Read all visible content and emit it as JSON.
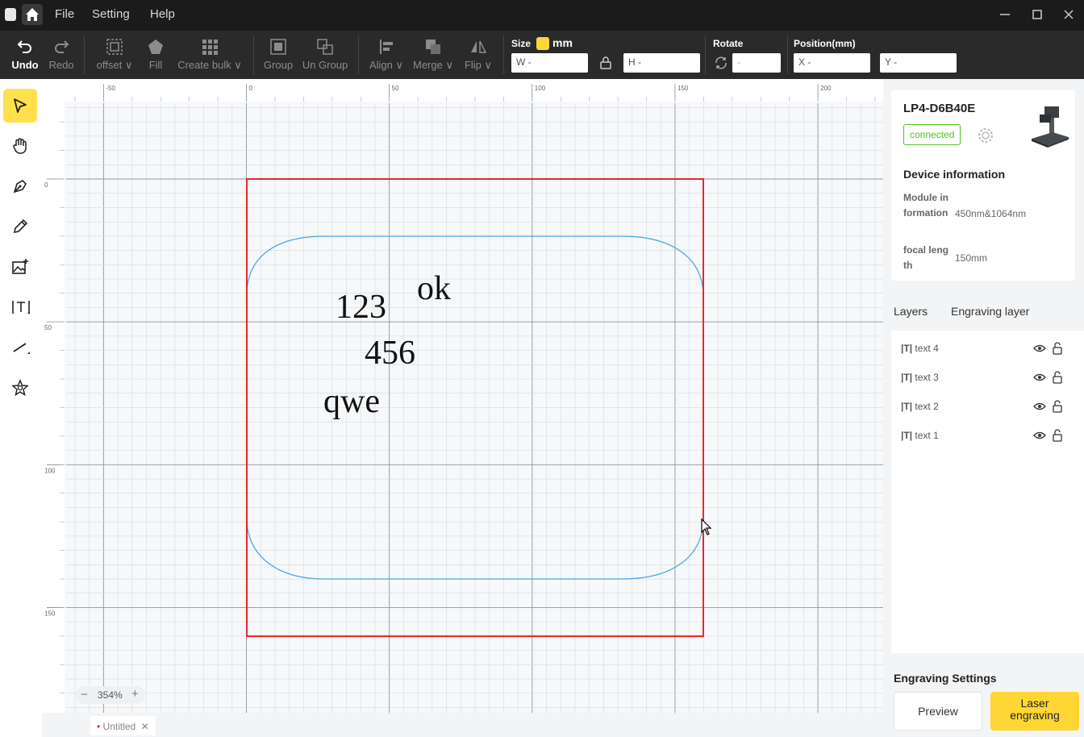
{
  "titlebar": {
    "menu": [
      "File",
      "Setting",
      "Help"
    ]
  },
  "toolbar": {
    "undo": "Undo",
    "redo": "Redo",
    "offset": "offset",
    "fill": "Fill",
    "create_bulk": "Create bulk",
    "group": "Group",
    "ungroup": "Un Group",
    "align": "Align",
    "merge": "Merge",
    "flip": "Flip",
    "size_label": "Size",
    "unit": "mm",
    "w_placeholder": "W -",
    "h_placeholder": "H -",
    "rotate_label": "Rotate",
    "rotate_value": "-",
    "position_label": "Position(mm)",
    "x_placeholder": "X -",
    "y_placeholder": "Y -"
  },
  "canvas": {
    "ruler_top": [
      "-50",
      "0",
      "50",
      "100",
      "150",
      "200"
    ],
    "ruler_left": [
      "0",
      "50",
      "100",
      "150"
    ],
    "texts": [
      "ok",
      "123",
      "456",
      "qwe"
    ],
    "zoom": "354%"
  },
  "tabs": [
    "Untitled"
  ],
  "device": {
    "name": "LP4-D6B40E",
    "status": "connected",
    "info_title": "Device information",
    "module_key": "Module information",
    "module_val": "450nm&1064nm",
    "focal_key": "focal length",
    "focal_val": "150mm"
  },
  "layers": {
    "tabs": [
      "Layers",
      "Engraving layer"
    ],
    "items": [
      "text 4",
      "text 3",
      "text 2",
      "text 1"
    ]
  },
  "engraving": {
    "title": "Engraving Settings",
    "preview": "Preview",
    "laser": "Laser engraving"
  },
  "colors": {
    "accent": "#ffd633",
    "selection": "#e8282b",
    "shape": "#4aa3df",
    "connected": "#52c41a"
  }
}
